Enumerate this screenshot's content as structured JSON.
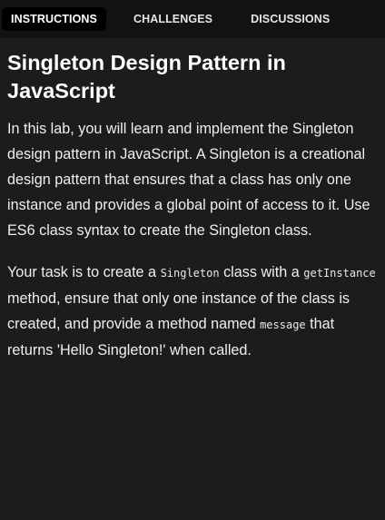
{
  "tabs": {
    "instructions": "INSTRUCTIONS",
    "challenges": "CHALLENGES",
    "discussions": "DISCUSSIONS"
  },
  "lab": {
    "title": "Singleton Design Pattern in JavaScript",
    "intro": "In this lab, you will learn and implement the Singleton design pattern in JavaScript. A Singleton is a creational design pattern that ensures that a class has only one instance and provides a global point of access to it. Use ES6 class syntax to create the Singleton class.",
    "task": {
      "t1": "Your task is to create a ",
      "code_singleton": "Singleton",
      "t2": " class with a ",
      "code_getinstance": "getInstance",
      "t3": " method, ensure that only one instance of the class is created, and provide a method named ",
      "code_message": "message",
      "t4": " that returns 'Hello Singleton!' when called."
    }
  },
  "colors": {
    "background": "#1c1c1c",
    "tabbar": "#121212",
    "active_tab": "#000000"
  }
}
